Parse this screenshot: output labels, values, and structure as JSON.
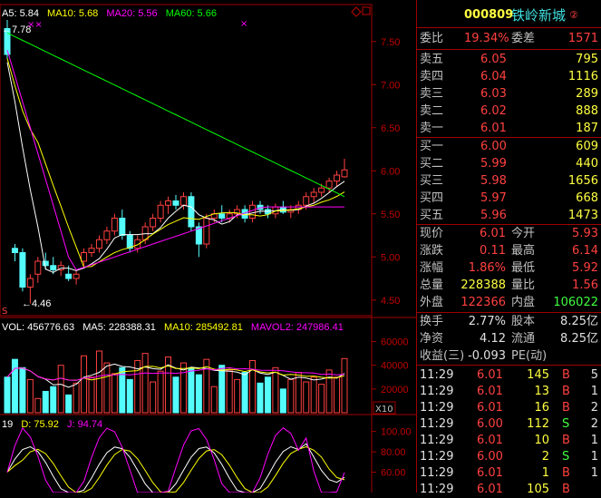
{
  "colors": {
    "up": "#ff4040",
    "down": "#54fcfc",
    "bg": "#000000",
    "grid": "#a00000",
    "ma5": "#ffffff",
    "ma10": "#ffff00",
    "ma20": "#ff00ff",
    "ma60": "#00ff00"
  },
  "price_panel": {
    "legend": [
      {
        "label": "A5: 5.84",
        "color": "#ffffff"
      },
      {
        "label": "MA10: 5.68",
        "color": "#ffff00"
      },
      {
        "label": "MA20: 5.56",
        "color": "#ff00ff"
      },
      {
        "label": "MA60: 5.66",
        "color": "#00ff00"
      }
    ],
    "high_label": "7.78",
    "low_label": "4.46",
    "axis_ticks": [
      "7.50",
      "7.00",
      "6.50",
      "6.00",
      "5.50",
      "5.00",
      "4.50"
    ],
    "icons": [
      "diamond-icon",
      "square-icon"
    ]
  },
  "volume_panel": {
    "legend": [
      {
        "label": "VOL: 456776.63",
        "color": "#ffffff"
      },
      {
        "label": "MA5: 228388.31",
        "color": "#ffffff"
      },
      {
        "label": "MA10: 285492.81",
        "color": "#ffff00"
      },
      {
        "label": "MAVOL2: 247986.41",
        "color": "#ff00ff"
      }
    ],
    "axis_ticks": [
      "60000",
      "40000",
      "20000"
    ],
    "unit_label": "X10"
  },
  "kdj_panel": {
    "legend": [
      {
        "label": "19",
        "color": "#ffffff"
      },
      {
        "label": "D: 75.92",
        "color": "#ffff00"
      },
      {
        "label": "J: 94.74",
        "color": "#ff00ff"
      }
    ],
    "axis_ticks": [
      "100.00",
      "80.00",
      "60.00"
    ]
  },
  "quote": {
    "code": "000809",
    "name": "铁岭新城",
    "badge": "②",
    "wei_bi_label": "委比",
    "wei_bi_value": "19.34%",
    "wei_cha_label": "委差",
    "wei_cha_value": "1571",
    "sell": [
      {
        "label": "卖五",
        "price": "6.05",
        "vol": "795"
      },
      {
        "label": "卖四",
        "price": "6.04",
        "vol": "1116"
      },
      {
        "label": "卖三",
        "price": "6.03",
        "vol": "289"
      },
      {
        "label": "卖二",
        "price": "6.02",
        "vol": "888"
      },
      {
        "label": "卖一",
        "price": "6.01",
        "vol": "187"
      }
    ],
    "buy": [
      {
        "label": "买一",
        "price": "6.00",
        "vol": "609"
      },
      {
        "label": "买二",
        "price": "5.99",
        "vol": "440"
      },
      {
        "label": "买三",
        "price": "5.98",
        "vol": "1656"
      },
      {
        "label": "买四",
        "price": "5.97",
        "vol": "668"
      },
      {
        "label": "买五",
        "price": "5.96",
        "vol": "1473"
      }
    ],
    "stats": [
      {
        "l1": "现价",
        "v1": "6.01",
        "c1": "red",
        "l2": "今开",
        "v2": "5.93",
        "c2": "red"
      },
      {
        "l1": "涨跌",
        "v1": "0.11",
        "c1": "red",
        "l2": "最高",
        "v2": "6.14",
        "c2": "red"
      },
      {
        "l1": "涨幅",
        "v1": "1.86%",
        "c1": "red",
        "l2": "最低",
        "v2": "5.92",
        "c2": "red"
      },
      {
        "l1": "总量",
        "v1": "228388",
        "c1": "yellow",
        "l2": "量比",
        "v2": "1.56",
        "c2": "red"
      },
      {
        "l1": "外盘",
        "v1": "122366",
        "c1": "red",
        "l2": "内盘",
        "v2": "106022",
        "c2": "green"
      }
    ],
    "stats2": [
      {
        "l1": "换手",
        "v1": "2.77%",
        "l2": "股本",
        "v2": "8.25亿"
      },
      {
        "l1": "净资",
        "v1": "4.12",
        "l2": "流通",
        "v2": "8.25亿"
      },
      {
        "l1": "收益(三)",
        "v1": "-0.093",
        "l2": "PE(动)",
        "v2": ""
      }
    ],
    "ticks": [
      {
        "time": "11:29",
        "price": "6.01",
        "vol": "145",
        "side": "B",
        "n": "5"
      },
      {
        "time": "11:29",
        "price": "6.01",
        "vol": "13",
        "side": "B",
        "n": "1"
      },
      {
        "time": "11:29",
        "price": "6.01",
        "vol": "16",
        "side": "B",
        "n": "2"
      },
      {
        "time": "11:29",
        "price": "6.00",
        "vol": "112",
        "side": "S",
        "n": "2"
      },
      {
        "time": "11:29",
        "price": "6.01",
        "vol": "10",
        "side": "B",
        "n": "1"
      },
      {
        "time": "11:29",
        "price": "6.00",
        "vol": "2",
        "side": "S",
        "n": "1"
      },
      {
        "time": "11:29",
        "price": "6.01",
        "vol": "1",
        "side": "B",
        "n": "1"
      },
      {
        "time": "11:29",
        "price": "6.01",
        "vol": "105",
        "side": "B",
        "n": ""
      }
    ]
  },
  "chart_data": {
    "type": "candlestick",
    "price_axis": [
      4.35,
      7.75
    ],
    "candles": [
      [
        7.65,
        7.75,
        7.3,
        7.35
      ],
      [
        5.1,
        5.15,
        4.95,
        5.05
      ],
      [
        5.05,
        5.1,
        4.6,
        4.65
      ],
      [
        4.65,
        4.8,
        4.46,
        4.75
      ],
      [
        4.8,
        5.0,
        4.7,
        4.95
      ],
      [
        4.95,
        5.05,
        4.85,
        4.9
      ],
      [
        4.9,
        5.0,
        4.8,
        4.85
      ],
      [
        4.85,
        4.95,
        4.78,
        4.9
      ],
      [
        4.8,
        4.9,
        4.72,
        4.75
      ],
      [
        4.75,
        4.85,
        4.68,
        4.8
      ],
      [
        4.95,
        5.1,
        4.9,
        5.05
      ],
      [
        5.05,
        5.15,
        5.0,
        5.1
      ],
      [
        5.1,
        5.25,
        5.05,
        5.2
      ],
      [
        5.2,
        5.35,
        5.15,
        5.3
      ],
      [
        5.3,
        5.5,
        5.25,
        5.45
      ],
      [
        5.45,
        5.55,
        5.2,
        5.25
      ],
      [
        5.25,
        5.3,
        5.05,
        5.1
      ],
      [
        5.1,
        5.25,
        5.05,
        5.2
      ],
      [
        5.2,
        5.4,
        5.15,
        5.35
      ],
      [
        5.35,
        5.5,
        5.3,
        5.45
      ],
      [
        5.45,
        5.65,
        5.4,
        5.6
      ],
      [
        5.6,
        5.7,
        5.5,
        5.65
      ],
      [
        5.65,
        5.72,
        5.55,
        5.6
      ],
      [
        5.6,
        5.75,
        5.55,
        5.7
      ],
      [
        5.7,
        5.75,
        5.3,
        5.35
      ],
      [
        5.35,
        5.4,
        5.0,
        5.15
      ],
      [
        5.15,
        5.5,
        5.1,
        5.45
      ],
      [
        5.45,
        5.55,
        5.4,
        5.5
      ],
      [
        5.5,
        5.6,
        5.4,
        5.45
      ],
      [
        5.45,
        5.55,
        5.4,
        5.5
      ],
      [
        5.5,
        5.6,
        5.45,
        5.55
      ],
      [
        5.55,
        5.6,
        5.4,
        5.45
      ],
      [
        5.45,
        5.65,
        5.4,
        5.6
      ],
      [
        5.6,
        5.65,
        5.5,
        5.55
      ],
      [
        5.55,
        5.6,
        5.45,
        5.5
      ],
      [
        5.5,
        5.62,
        5.45,
        5.58
      ],
      [
        5.58,
        5.65,
        5.5,
        5.52
      ],
      [
        5.52,
        5.6,
        5.45,
        5.55
      ],
      [
        5.55,
        5.65,
        5.5,
        5.6
      ],
      [
        5.6,
        5.75,
        5.55,
        5.7
      ],
      [
        5.7,
        5.8,
        5.62,
        5.75
      ],
      [
        5.75,
        5.85,
        5.7,
        5.8
      ],
      [
        5.8,
        5.92,
        5.75,
        5.88
      ],
      [
        5.88,
        6.0,
        5.82,
        5.95
      ],
      [
        5.93,
        6.14,
        5.92,
        6.01
      ]
    ],
    "volumes": [
      30000,
      45000,
      38000,
      28000,
      12000,
      18000,
      22000,
      40000,
      15000,
      25000,
      48000,
      30000,
      52000,
      42000,
      33000,
      38000,
      28000,
      44000,
      50000,
      26000,
      35000,
      47000,
      30000,
      42000,
      38000,
      32000,
      45000,
      22000,
      40000,
      36000,
      28000,
      34000,
      44000,
      25000,
      30000,
      38000,
      20000,
      28000,
      34000,
      26000,
      30000,
      24000,
      36000,
      30000,
      45677
    ]
  }
}
